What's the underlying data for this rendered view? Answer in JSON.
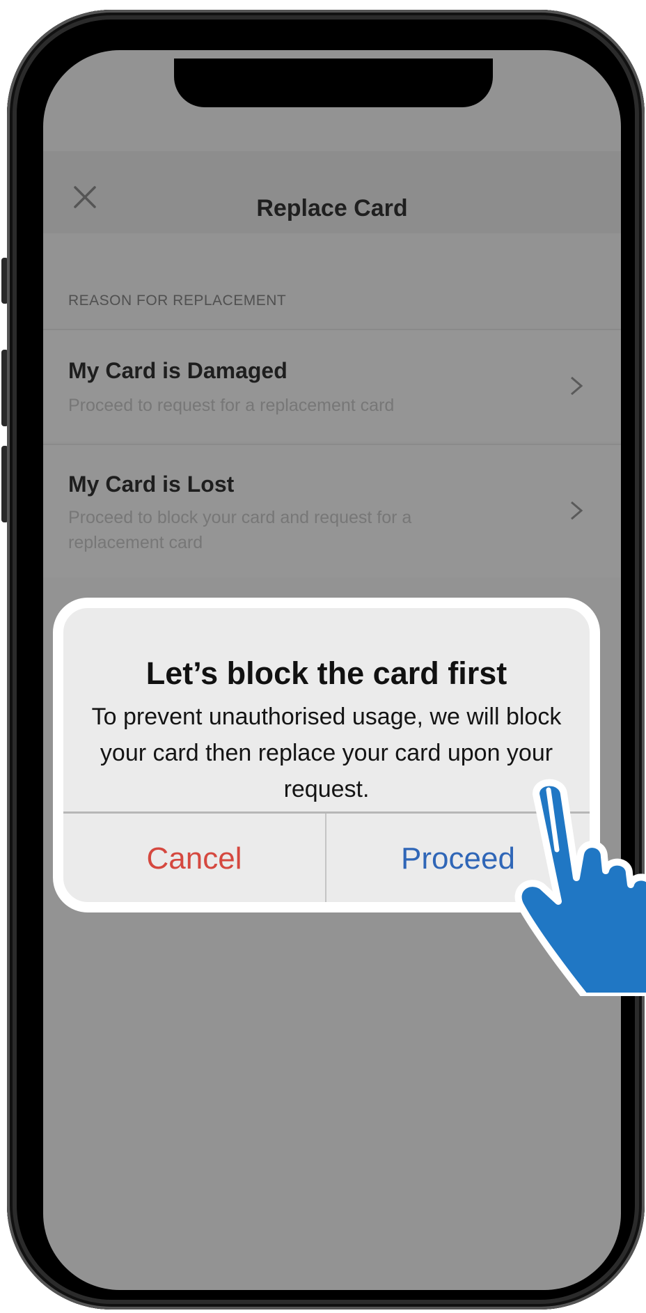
{
  "header": {
    "title": "Replace Card",
    "close_icon": "close-icon"
  },
  "section": {
    "label": "REASON FOR REPLACEMENT"
  },
  "options": [
    {
      "title": "My Card is Damaged",
      "subtitle": "Proceed to request for a replacement card",
      "icon": "chevron-right-icon"
    },
    {
      "title": "My Card is Lost",
      "subtitle": "Proceed to block your card and request for a replacement card",
      "icon": "chevron-right-icon"
    }
  ],
  "dialog": {
    "title": "Let’s block the card first",
    "message": "To prevent unauthorised usage, we will block your card then replace your card upon your request.",
    "cancel_label": "Cancel",
    "proceed_label": "Proceed"
  },
  "colors": {
    "cancel": "#d5483f",
    "proceed": "#2f66b7",
    "pointer_hand": "#2077c4"
  },
  "overlay_icon": "pointing-hand-icon"
}
